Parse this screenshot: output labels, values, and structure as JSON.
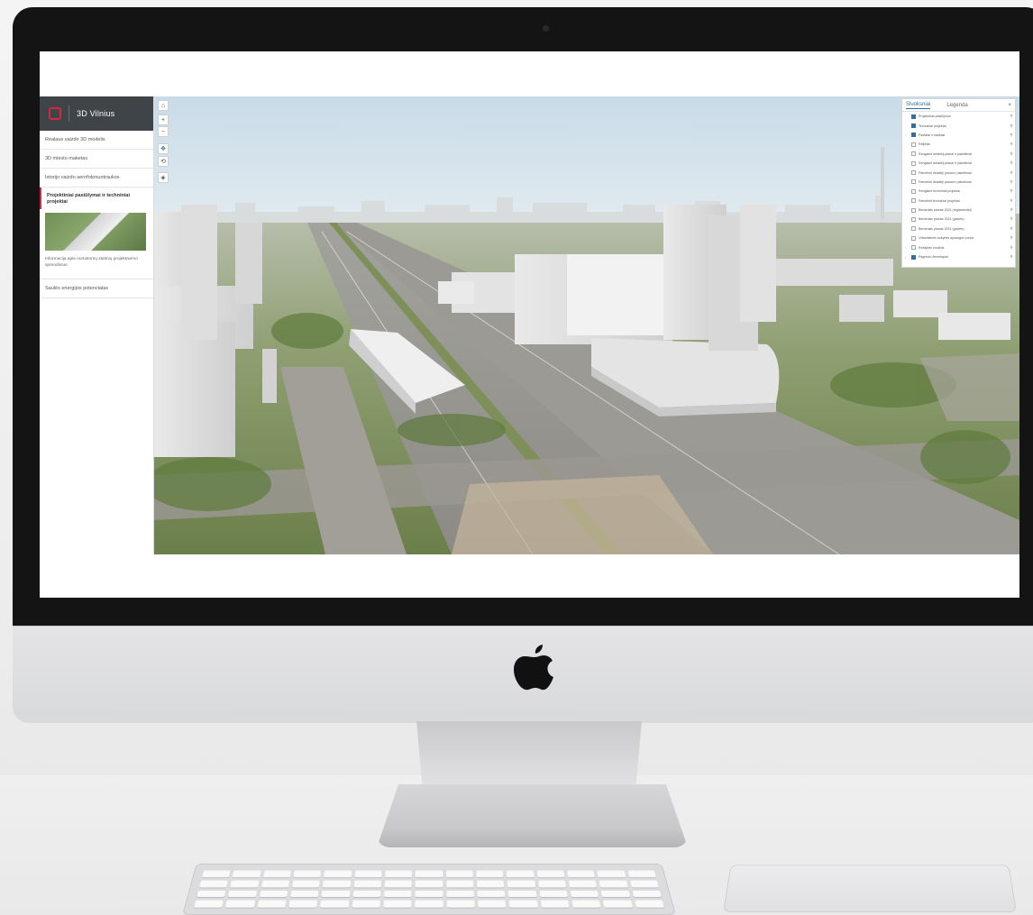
{
  "app": {
    "title": "3D Vilnius"
  },
  "sidebar": {
    "items": [
      {
        "label": "Realaus vaizdo 3D modelis"
      },
      {
        "label": "3D miesto maketas"
      },
      {
        "label": "Istorijo vaizdo aerofotonuotraukos"
      },
      {
        "label": "Projektiniai pasiūlymai ir techniniai projektai",
        "active": true
      },
      {
        "label": "Saulės energijos potencialas"
      }
    ],
    "active_description": "Informacija apie numatomų statinių projektavimo sprendinius."
  },
  "map_controls": [
    {
      "icon": "home-icon",
      "glyph": "⌂"
    },
    {
      "icon": "zoom-in-icon",
      "glyph": "+"
    },
    {
      "icon": "zoom-out-icon",
      "glyph": "−"
    },
    {
      "icon": "pan-icon",
      "glyph": "✥"
    },
    {
      "icon": "rotate-icon",
      "glyph": "⟲"
    },
    {
      "icon": "compass-icon",
      "glyph": "◈"
    }
  ],
  "layers_panel": {
    "tabs": [
      {
        "label": "Sluoksniai",
        "active": true
      },
      {
        "label": "Legenda",
        "active": false
      }
    ],
    "close_glyph": "×",
    "rows": [
      {
        "label": "Projektiniai pasiūlymai",
        "checked": true,
        "expandable": false
      },
      {
        "label": "Techniniai projektai",
        "checked": true,
        "expandable": false
      },
      {
        "label": "Pastatai ir statiniai",
        "checked": true,
        "expandable": true
      },
      {
        "label": "Reljefas",
        "checked": false,
        "expandable": false
      },
      {
        "label": "Rengiami detalieji planai ir pakeitimai",
        "checked": false,
        "expandable": false
      },
      {
        "label": "Rengiami detalieji planai ir pakeitimai",
        "checked": false,
        "expandable": false
      },
      {
        "label": "Patvirtinti detalieji planai ir pakeitimai",
        "checked": false,
        "expandable": false
      },
      {
        "label": "Patvirtinti detalieji planai ir pakeitimai",
        "checked": false,
        "expandable": false
      },
      {
        "label": "Rengiami techniniai projektai",
        "checked": false,
        "expandable": false
      },
      {
        "label": "Patvirtinti techniniai projektai",
        "checked": false,
        "expandable": false
      },
      {
        "label": "Bendrasis planas 2021 (reglamentai)",
        "checked": false,
        "expandable": false
      },
      {
        "label": "Bendrasis planas 2021 (gatvės)",
        "checked": false,
        "expandable": false
      },
      {
        "label": "Bendrasis planas 2021 (gatvės)",
        "checked": false,
        "expandable": false
      },
      {
        "label": "Urbanistinės kokybės apsaugos zonos",
        "checked": false,
        "expandable": false
      },
      {
        "label": "Realybės modelis",
        "checked": false,
        "expandable": true
      },
      {
        "label": "Pagrindo žemėlapiai",
        "checked": true,
        "expandable": true
      }
    ],
    "tool_glyph": "⚲"
  },
  "colors": {
    "accent": "#d7263d",
    "header_bg": "#3f4449",
    "link_blue": "#2e6fa8"
  }
}
